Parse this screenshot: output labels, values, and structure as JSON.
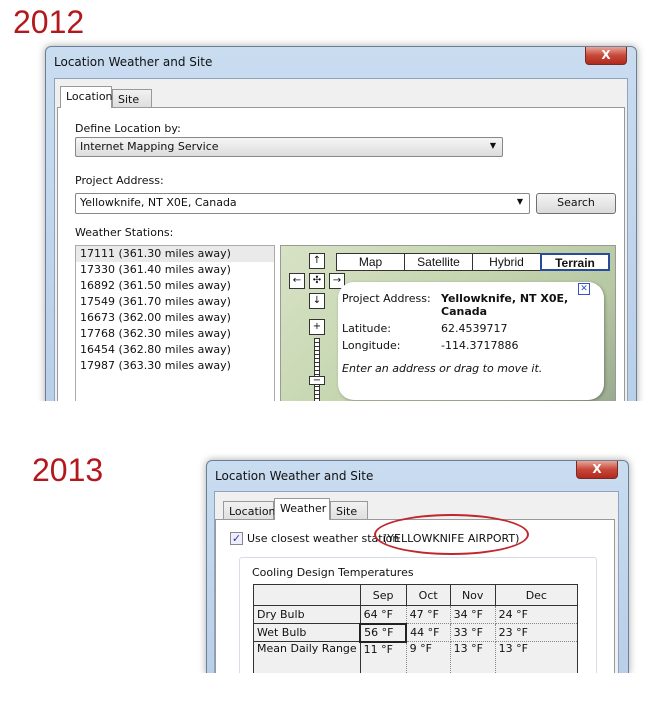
{
  "year_2012": "2012",
  "year_2013": "2013",
  "dialog_2012": {
    "title": "Location Weather and Site",
    "close_icon": "close-x-icon",
    "tabs": [
      "Location",
      "Site"
    ],
    "define_label": "Define Location by:",
    "define_value": "Internet Mapping Service",
    "address_label": "Project Address:",
    "address_value": "Yellowknife, NT X0E, Canada",
    "search_label": "Search",
    "stations_label": "Weather Stations:",
    "stations": [
      "17111 (361.30 miles away)",
      "17330 (361.40 miles away)",
      "16892 (361.50 miles away)",
      "17549 (361.70 miles away)",
      "16673 (362.00 miles away)",
      "17768 (362.30 miles away)",
      "16454 (362.80 miles away)",
      "17987 (363.30 miles away)"
    ],
    "map": {
      "types": [
        "Map",
        "Satellite",
        "Hybrid",
        "Terrain"
      ],
      "active_type": "Terrain",
      "nav": {
        "up": "↑",
        "left": "←",
        "center": "✣",
        "right": "→",
        "down": "↓",
        "zoom_in": "+",
        "zoom_out": "−"
      },
      "popup": {
        "address_label": "Project Address:",
        "address_line1": "Yellowknife, NT X0E,",
        "address_line2": "Canada",
        "lat_label": "Latitude:",
        "lat_value": "62.4539717",
        "lon_label": "Longitude:",
        "lon_value": "-114.3717886",
        "hint": "Enter an address or drag to move it.",
        "close": "✕"
      }
    }
  },
  "dialog_2013": {
    "title": "Location Weather and Site",
    "tabs": [
      "Location",
      "Weather",
      "Site"
    ],
    "active_tab": "Weather",
    "use_closest_label": "Use closest weather station",
    "use_closest_checked": true,
    "station_name": "(YELLOWKNIFE AIRPORT)",
    "highlight_color": "#c0272d",
    "group_title": "Cooling Design Temperatures",
    "columns": [
      "",
      "Sep",
      "Oct",
      "Nov",
      "Dec"
    ],
    "rows": [
      [
        "Dry Bulb",
        "64 °F",
        "47 °F",
        "34 °F",
        "24 °F"
      ],
      [
        "Wet Bulb",
        "56 °F",
        "44 °F",
        "33 °F",
        "23 °F"
      ],
      [
        "Mean Daily Range",
        "11 °F",
        "9 °F",
        "13 °F",
        "13 °F"
      ]
    ]
  }
}
